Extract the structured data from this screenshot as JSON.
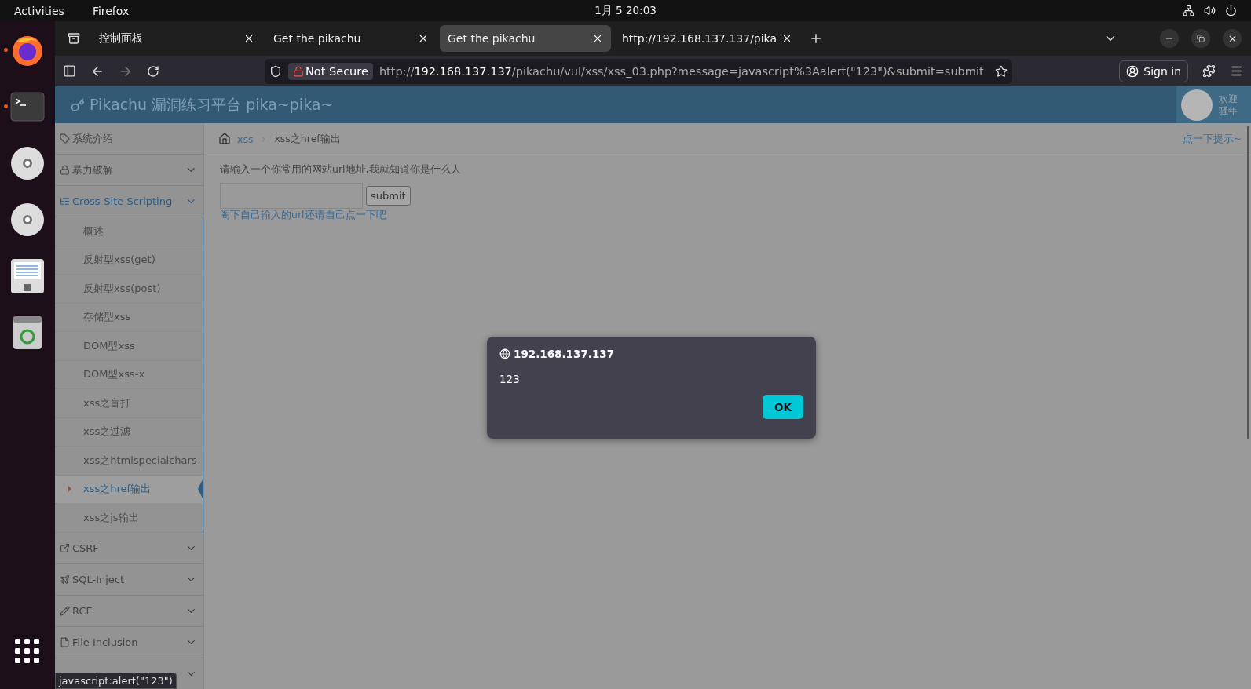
{
  "top_bar": {
    "activities": "Activities",
    "app": "Firefox",
    "clock": "1月 5  20:03"
  },
  "dock": [
    {
      "kind": "firefox",
      "running": true
    },
    {
      "kind": "terminal",
      "running": true
    },
    {
      "kind": "disc",
      "running": false
    },
    {
      "kind": "disc",
      "running": false
    },
    {
      "kind": "editor",
      "running": false
    },
    {
      "kind": "trash",
      "running": false
    }
  ],
  "tabs": [
    {
      "title": "控制面板",
      "selected": false
    },
    {
      "title": "Get the pikachu",
      "selected": false
    },
    {
      "title": "Get the pikachu",
      "selected": true
    },
    {
      "title": "http://192.168.137.137/pika",
      "selected": false
    }
  ],
  "nav": {
    "security": "Not Secure",
    "url_scheme": "http://",
    "url_host": "192.168.137.137",
    "url_path": "/pikachu/vul/xss/xss_03.php?message=javascript%3Aalert(\"123\")&submit=submit",
    "sign_in": "Sign in"
  },
  "header": {
    "title": "Pikachu 漏洞练习平台 pika~pika~",
    "welcome": "欢迎",
    "user": "骚年"
  },
  "sidebar": [
    {
      "label": "系统介绍",
      "expandable": false,
      "expanded": false
    },
    {
      "label": "暴力破解",
      "expandable": true,
      "expanded": false
    },
    {
      "label": "Cross-Site Scripting",
      "expandable": true,
      "expanded": true,
      "children": [
        {
          "label": "概述",
          "selected": false
        },
        {
          "label": "反射型xss(get)",
          "selected": false
        },
        {
          "label": "反射型xss(post)",
          "selected": false
        },
        {
          "label": "存储型xss",
          "selected": false
        },
        {
          "label": "DOM型xss",
          "selected": false
        },
        {
          "label": "DOM型xss-x",
          "selected": false
        },
        {
          "label": "xss之盲打",
          "selected": false
        },
        {
          "label": "xss之过滤",
          "selected": false
        },
        {
          "label": "xss之htmlspecialchars",
          "selected": false
        },
        {
          "label": "xss之href输出",
          "selected": true
        },
        {
          "label": "xss之js输出",
          "selected": false
        }
      ]
    },
    {
      "label": "CSRF",
      "expandable": true,
      "expanded": false
    },
    {
      "label": "SQL-Inject",
      "expandable": true,
      "expanded": false
    },
    {
      "label": "RCE",
      "expandable": true,
      "expanded": false
    },
    {
      "label": "File Inclusion",
      "expandable": true,
      "expanded": false
    },
    {
      "expandable": true,
      "expanded": false
    }
  ],
  "breadcrumb": [
    "xss",
    "xss之href输出"
  ],
  "hint": "点一下提示~",
  "form": {
    "prompt": "请输入一个你常用的网站url地址,我就知道你是什么人",
    "button": "submit",
    "note": "阁下自己输入的url还请自己点一下吧"
  },
  "dialog": {
    "origin": "192.168.137.137",
    "message": "123",
    "ok": "OK"
  },
  "status_link": "javascript:alert(\"123\")"
}
